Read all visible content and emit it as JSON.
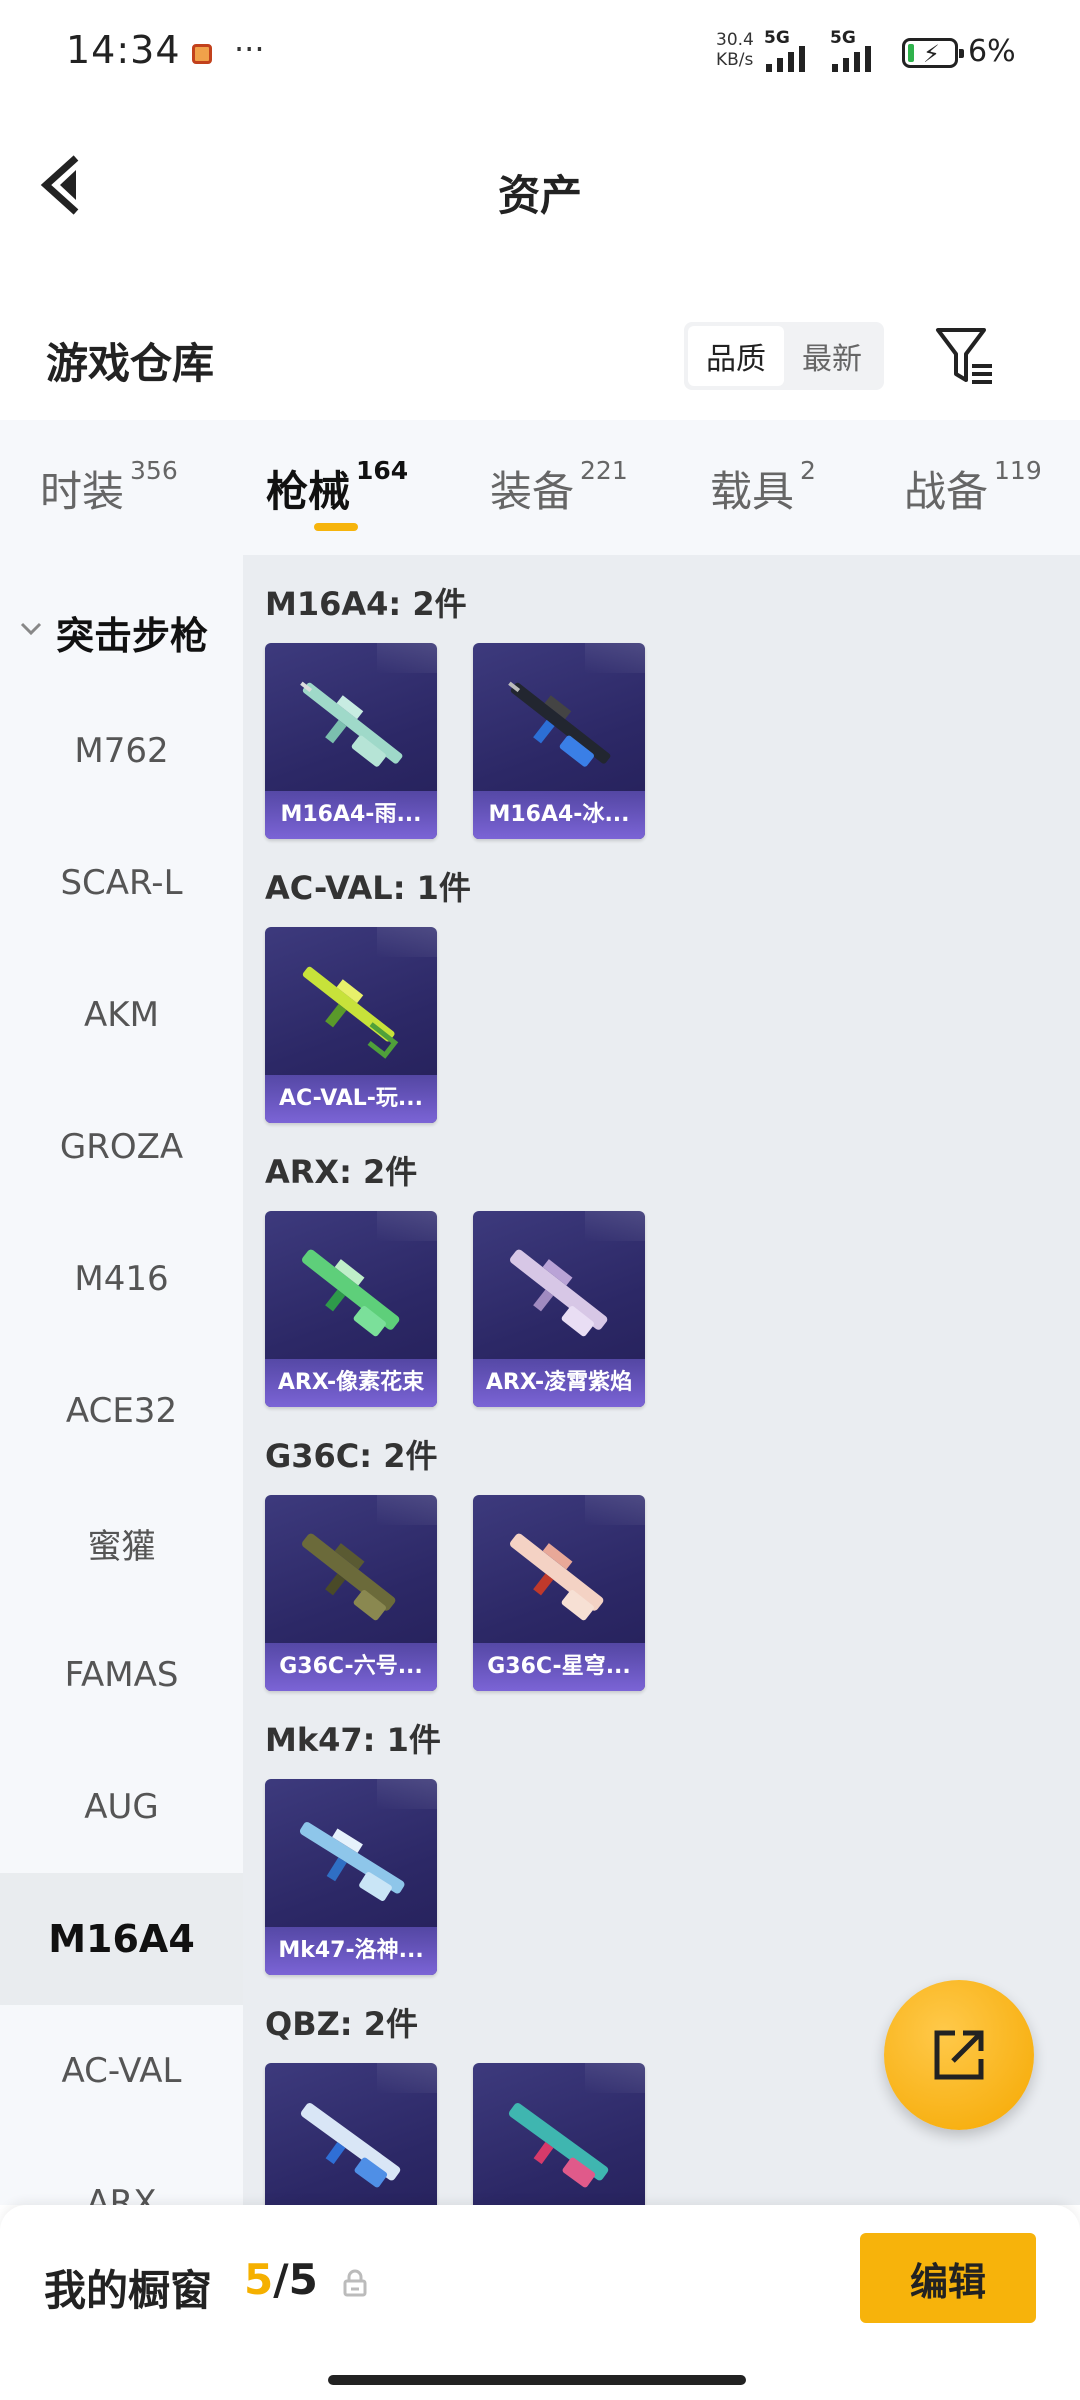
{
  "status_bar": {
    "time": "14:34",
    "more": "···",
    "net_speed_value": "30.4",
    "net_speed_unit": "KB/s",
    "sim1": "5G",
    "sim2": "5G",
    "battery": "6%"
  },
  "header": {
    "title": "资产"
  },
  "warehouse": {
    "title": "游戏仓库",
    "sort_options": [
      "品质",
      "最新"
    ],
    "sort_selected": "品质"
  },
  "tabs": [
    {
      "label": "时装",
      "count": "356"
    },
    {
      "label": "枪械",
      "count": "164",
      "active": true
    },
    {
      "label": "装备",
      "count": "221"
    },
    {
      "label": "载具",
      "count": "2"
    },
    {
      "label": "战备",
      "count": "119"
    }
  ],
  "sidebar": {
    "group": "突击步枪",
    "items": [
      "M762",
      "SCAR-L",
      "AKM",
      "GROZA",
      "M416",
      "ACE32",
      "蜜獾",
      "FAMAS",
      "AUG",
      "M16A4",
      "AC-VAL",
      "ARX"
    ],
    "active": "M16A4"
  },
  "groups": [
    {
      "title": "M16A4: 2件",
      "items": [
        "M16A4-雨...",
        "M16A4-冰..."
      ]
    },
    {
      "title": "AC-VAL: 1件",
      "items": [
        "AC-VAL-玩..."
      ]
    },
    {
      "title": "ARX: 2件",
      "items": [
        "ARX-像素花束",
        "ARX-凌霄紫焰"
      ]
    },
    {
      "title": "G36C: 2件",
      "items": [
        "G36C-六号...",
        "G36C-星穹..."
      ]
    },
    {
      "title": "Mk47: 1件",
      "items": [
        "Mk47-洛神..."
      ]
    },
    {
      "title": "QBZ: 2件",
      "items": [
        "",
        ""
      ]
    }
  ],
  "bottom_bar": {
    "label": "我的橱窗",
    "current": "5",
    "total": "/5",
    "edit_label": "编辑"
  },
  "colors": {
    "accent": "#f7b30b",
    "card_bg": "#2c2866",
    "sidebar_bg": "#f6f8fb",
    "content_bg": "#eaedf1"
  }
}
